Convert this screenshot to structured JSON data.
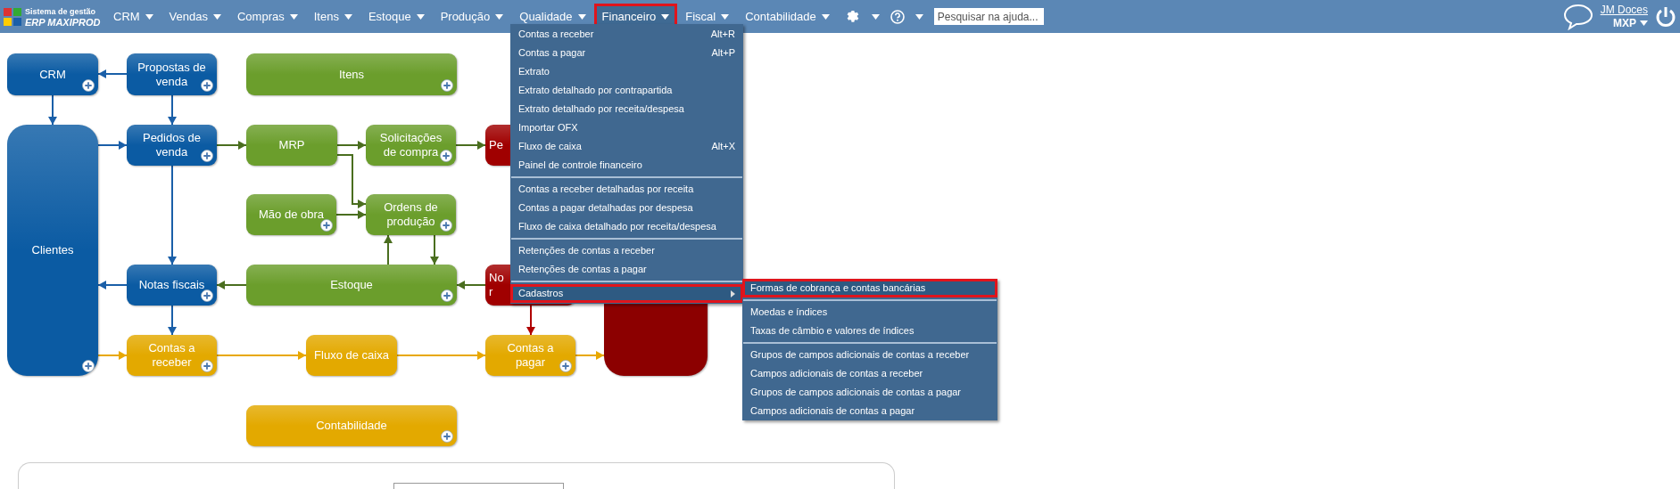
{
  "app": {
    "logo_line1": "Sistema de gestão",
    "logo_line2": "ERP MAXIPROD"
  },
  "nav": [
    {
      "label": "CRM",
      "selected": false
    },
    {
      "label": "Vendas",
      "selected": false
    },
    {
      "label": "Compras",
      "selected": false
    },
    {
      "label": "Itens",
      "selected": false
    },
    {
      "label": "Estoque",
      "selected": false
    },
    {
      "label": "Produção",
      "selected": false
    },
    {
      "label": "Qualidade",
      "selected": false
    },
    {
      "label": "Financeiro",
      "selected": true
    },
    {
      "label": "Fiscal",
      "selected": false
    },
    {
      "label": "Contabilidade",
      "selected": false
    }
  ],
  "search": {
    "placeholder": "Pesquisar na ajuda..."
  },
  "user": {
    "company": "JM Doces",
    "code": "MXP"
  },
  "menu": {
    "groups": [
      [
        {
          "label": "Contas a receber",
          "shortcut": "Alt+R",
          "selected": false,
          "submenu": false
        },
        {
          "label": "Contas a pagar",
          "shortcut": "Alt+P",
          "selected": false,
          "submenu": false
        },
        {
          "label": "Extrato",
          "selected": false,
          "submenu": false
        },
        {
          "label": "Extrato detalhado por contrapartida",
          "selected": false,
          "submenu": false
        },
        {
          "label": "Extrato detalhado por receita/despesa",
          "selected": false,
          "submenu": false
        },
        {
          "label": "Importar OFX",
          "selected": false,
          "submenu": false
        },
        {
          "label": "Fluxo de caixa",
          "shortcut": "Alt+X",
          "selected": false,
          "submenu": false
        },
        {
          "label": "Painel de controle financeiro",
          "selected": false,
          "submenu": false
        }
      ],
      [
        {
          "label": "Contas a receber detalhadas por receita",
          "selected": false,
          "submenu": false
        },
        {
          "label": "Contas a pagar detalhadas por despesa",
          "selected": false,
          "submenu": false
        },
        {
          "label": "Fluxo de caixa detalhado por receita/despesa",
          "selected": false,
          "submenu": false
        }
      ],
      [
        {
          "label": "Retenções de contas a receber",
          "selected": false,
          "submenu": false
        },
        {
          "label": "Retenções de contas a pagar",
          "selected": false,
          "submenu": false
        }
      ],
      [
        {
          "label": "Cadastros",
          "selected": true,
          "submenu": true
        }
      ]
    ]
  },
  "submenu": {
    "groups": [
      [
        {
          "label": "Formas de cobrança e contas bancárias",
          "selected": true
        }
      ],
      [
        {
          "label": "Moedas e índices",
          "selected": false
        },
        {
          "label": "Taxas de câmbio e valores de índices",
          "selected": false
        }
      ],
      [
        {
          "label": "Grupos de campos adicionais de contas a receber",
          "selected": false
        },
        {
          "label": "Campos adicionais de contas a receber",
          "selected": false
        },
        {
          "label": "Grupos de campos adicionais de contas a pagar",
          "selected": false
        },
        {
          "label": "Campos adicionais de contas a pagar",
          "selected": false
        }
      ]
    ]
  },
  "diagram": {
    "nodes": [
      {
        "label": "CRM",
        "color": "#0b5ba3",
        "plus": true
      },
      {
        "label": "Propostas de venda",
        "color": "#0b5ba3",
        "plus": true
      },
      {
        "label": "Itens",
        "color": "#6b9e2c",
        "plus": true
      },
      {
        "label": "Clientes",
        "color": "#0b5ba3",
        "plus": true
      },
      {
        "label": "Pedidos de venda",
        "color": "#0b5ba3",
        "plus": true
      },
      {
        "label": "MRP",
        "color": "#6b9e2c",
        "plus": false
      },
      {
        "label": "Solicitações de compra",
        "color": "#6b9e2c",
        "plus": true
      },
      {
        "label": "Pe",
        "color": "#a00000"
      },
      {
        "label": "Mão de obra",
        "color": "#6b9e2c",
        "plus": true
      },
      {
        "label": "Ordens de produção",
        "color": "#6b9e2c",
        "plus": true
      },
      {
        "label": "Notas fiscais",
        "color": "#0b5ba3",
        "plus": true
      },
      {
        "label": "Estoque",
        "color": "#6b9e2c",
        "plus": true
      },
      {
        "label": "No r",
        "color": "#a00000"
      },
      {
        "label": "Contas a receber",
        "color": "#e3a900",
        "plus": true
      },
      {
        "label": "Fluxo de caixa",
        "color": "#e3a900",
        "plus": false
      },
      {
        "label": "Contas a pagar",
        "color": "#e3a900",
        "plus": true
      },
      {
        "color": "#8c0000"
      },
      {
        "label": "Contabilidade",
        "color": "#e3a900",
        "plus": true
      }
    ]
  }
}
